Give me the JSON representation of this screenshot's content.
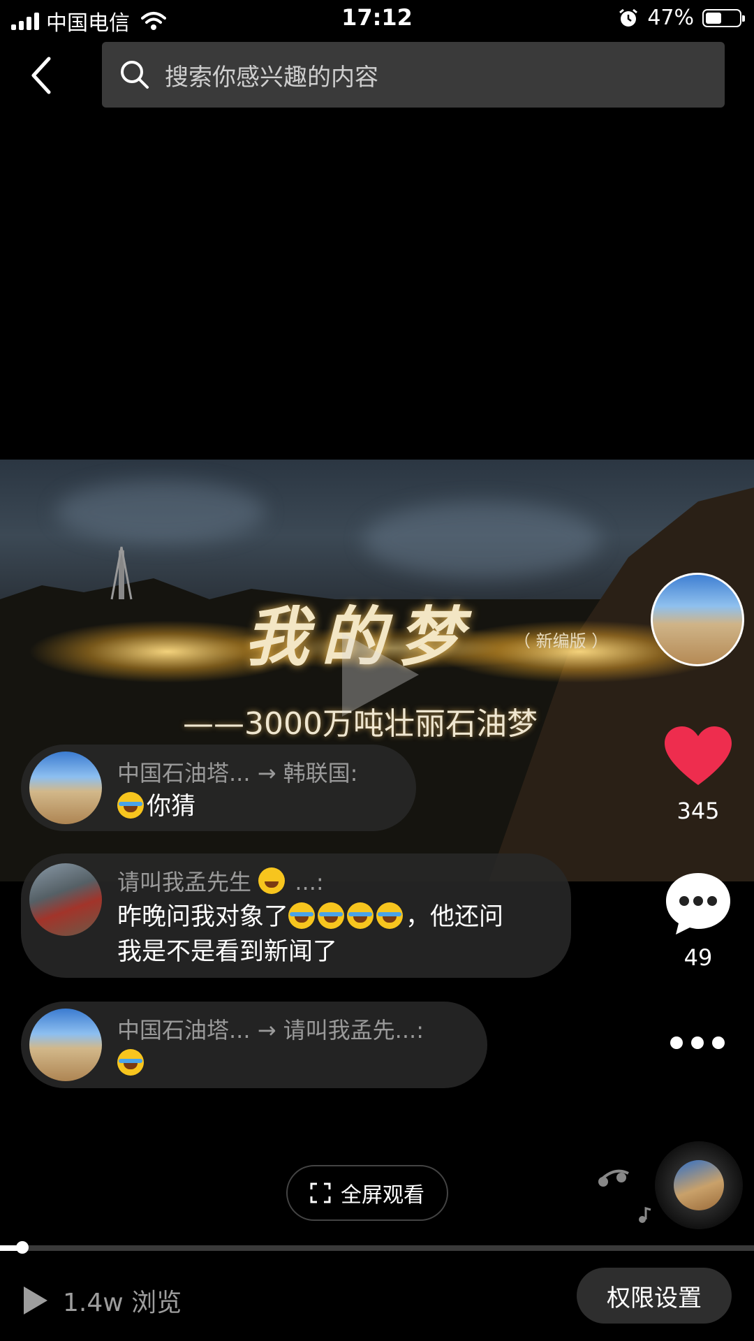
{
  "status_bar": {
    "carrier": "中国电信",
    "time": "17:12",
    "battery_percent": "47%",
    "battery_level": 0.47
  },
  "search": {
    "placeholder": "搜索你感兴趣的内容"
  },
  "video": {
    "title": "我的梦",
    "note": "（ 新编版 ）",
    "subtitle": "——3000万吨壮丽石油梦"
  },
  "actions": {
    "like_count": "345",
    "comment_count": "49"
  },
  "comments": [
    {
      "name": "中国石油塔... → 韩联国:",
      "text": "你猜",
      "emojis_before": 1
    },
    {
      "name": "请叫我孟先生",
      "name_suffix": "...:",
      "text_a": "昨晚问我对象了",
      "text_b": "，他还问",
      "text_c": "我是不是看到新闻了"
    },
    {
      "name": "中国石油塔... → 请叫我孟先...:",
      "text": ""
    }
  ],
  "bottom": {
    "fullscreen_label": "全屏观看",
    "views": "1.4w 浏览",
    "permission_button": "权限设置",
    "progress": 0.03
  }
}
